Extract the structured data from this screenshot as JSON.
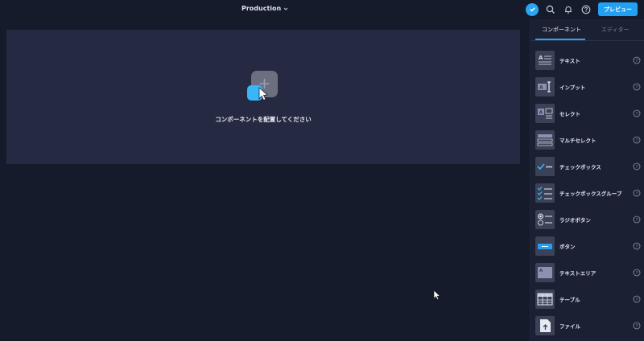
{
  "topbar": {
    "environment_label": "Production",
    "preview_label": "プレビュー",
    "icons": [
      "check-icon",
      "search-icon",
      "bell-icon",
      "help-icon",
      "chevron-down-icon"
    ],
    "accent_color": "#22a1f2"
  },
  "canvas": {
    "placeholder_message": "コンポーネントを配置してください"
  },
  "panel": {
    "tabs": [
      {
        "label": "コンポーネント",
        "active": true
      },
      {
        "label": "エディター",
        "active": false
      }
    ],
    "components": [
      {
        "label": "テキスト",
        "icon": "text-component-icon"
      },
      {
        "label": "インプット",
        "icon": "input-component-icon"
      },
      {
        "label": "セレクト",
        "icon": "select-component-icon"
      },
      {
        "label": "マルチセレクト",
        "icon": "multiselect-component-icon"
      },
      {
        "label": "チェックボックス",
        "icon": "checkbox-component-icon"
      },
      {
        "label": "チェックボックスグループ",
        "icon": "checkbox-group-component-icon"
      },
      {
        "label": "ラジオボタン",
        "icon": "radio-component-icon"
      },
      {
        "label": "ボタン",
        "icon": "button-component-icon"
      },
      {
        "label": "テキストエリア",
        "icon": "textarea-component-icon"
      },
      {
        "label": "テーブル",
        "icon": "table-component-icon"
      },
      {
        "label": "ファイル",
        "icon": "file-component-icon"
      }
    ]
  }
}
